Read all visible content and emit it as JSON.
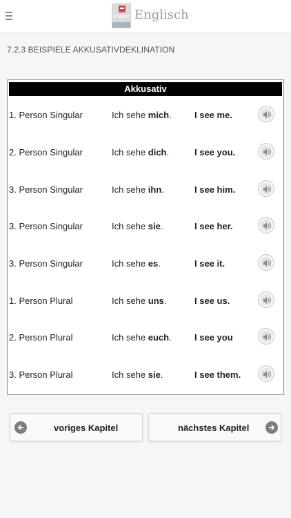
{
  "header": {
    "app_title": "Englisch",
    "logo_text": "Englisch",
    "menu_icon": "hamburger-menu-icon"
  },
  "section": {
    "title": "7.2.3 BEISPIELE AKKUSATIVDEKLINATION"
  },
  "table": {
    "heading": "Akkusativ",
    "audio_icon": "speaker-icon",
    "rows": [
      {
        "person": "1. Person Singular",
        "de_prefix": "Ich sehe ",
        "de_pronoun": "mich",
        "de_suffix": ".",
        "en": "I see me."
      },
      {
        "person": "2. Person Singular",
        "de_prefix": "Ich sehe ",
        "de_pronoun": "dich",
        "de_suffix": ".",
        "en": "I see you."
      },
      {
        "person": "3. Person Singular",
        "de_prefix": "Ich sehe ",
        "de_pronoun": "ihn",
        "de_suffix": ".",
        "en": "I see him."
      },
      {
        "person": "3. Person Singular",
        "de_prefix": "Ich sehe ",
        "de_pronoun": "sie",
        "de_suffix": ".",
        "en": "I see her."
      },
      {
        "person": "3. Person Singular",
        "de_prefix": "Ich sehe ",
        "de_pronoun": "es",
        "de_suffix": ".",
        "en": "I see it."
      },
      {
        "person": "1. Person Plural",
        "de_prefix": "Ich sehe ",
        "de_pronoun": "uns",
        "de_suffix": ".",
        "en": "I see us."
      },
      {
        "person": "2. Person Plural",
        "de_prefix": "Ich sehe ",
        "de_pronoun": "euch",
        "de_suffix": ".",
        "en": "I see you"
      },
      {
        "person": "3. Person Plural",
        "de_prefix": "Ich sehe ",
        "de_pronoun": "sie",
        "de_suffix": ".",
        "en": "I see them."
      }
    ]
  },
  "nav": {
    "prev_label": "voriges Kapitel",
    "prev_icon": "arrow-left-icon",
    "next_label": "nächstes Kapitel",
    "next_icon": "arrow-right-icon"
  },
  "colors": {
    "table_header_bg": "#000000",
    "nav_arrow_circle": "#7d7d7d"
  }
}
